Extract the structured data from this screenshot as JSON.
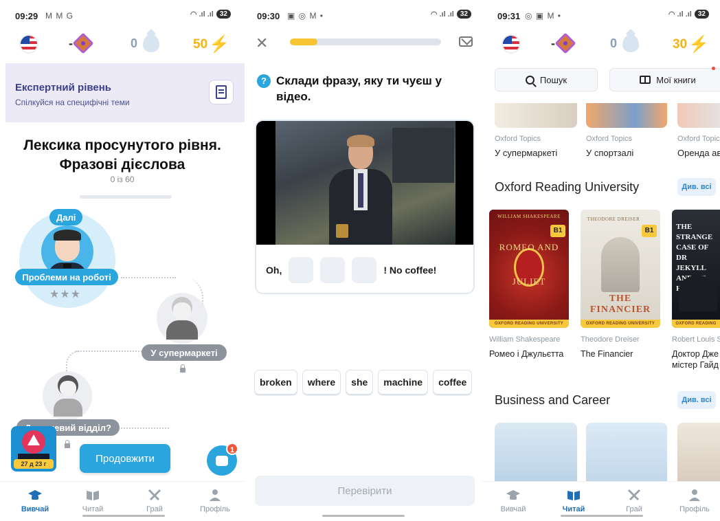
{
  "screen1": {
    "status": {
      "time": "09:29",
      "icons": "M M G",
      "battery": "32"
    },
    "top": {
      "gem_value": "-",
      "drops": "0",
      "energy": "50"
    },
    "expert": {
      "title": "Експертний рівень",
      "subtitle": "Спілкуйся на специфічні теми"
    },
    "lesson": {
      "title_line1": "Лексика просунутого рівня.",
      "title_line2": "Фразові дієслова",
      "progress": "0 із 60"
    },
    "path": {
      "next_label": "Далі",
      "nodes": [
        {
          "label": "Проблеми на роботі",
          "stars": "★★★"
        },
        {
          "label": "У супермаркеті"
        },
        {
          "label": "Д...овчевий відділ?"
        }
      ]
    },
    "promo_timer": "27 д 23 г",
    "continue_label": "Продовжити",
    "chat_badge": "1",
    "nav": [
      {
        "label": "Вивчай",
        "active": true
      },
      {
        "label": "Читай",
        "active": false
      },
      {
        "label": "Грай",
        "active": false
      },
      {
        "label": "Профіль",
        "active": false
      }
    ]
  },
  "screen2": {
    "status": {
      "time": "09:30",
      "icons": "▣ ◎ M •",
      "battery": "32"
    },
    "progress_fraction": 0.18,
    "question": "Склади фразу, яку ти чуєш у відео.",
    "answer": {
      "prefix": "Oh,",
      "suffix": "! No coffee!"
    },
    "words": [
      "broken",
      "where",
      "she",
      "machine",
      "coffee"
    ],
    "check_label": "Перевірити"
  },
  "screen3": {
    "status": {
      "time": "09:31",
      "icons": "◎ ▣ M •",
      "battery": "32"
    },
    "top": {
      "gem_value": "-",
      "drops": "0",
      "energy": "30"
    },
    "search_label": "Пошук",
    "my_books_label": "Мої книги",
    "topics": [
      {
        "source": "Oxford Topics",
        "name": "У супермаркеті"
      },
      {
        "source": "Oxford Topics",
        "name": "У спортзалі"
      },
      {
        "source": "Oxford Topic",
        "name": "Оренда ав"
      }
    ],
    "section1": {
      "title": "Oxford Reading University",
      "see_all": "Див. всі"
    },
    "books": [
      {
        "author": "William Shakespeare",
        "title": "Ромео і Джульєтта",
        "cover": "ROMEO AND JULIET",
        "cover_author": "WILLIAM SHAKESPEARE",
        "level": "B1",
        "series": "OXFORD READING UNIVERSITY"
      },
      {
        "author": "Theodore Dreiser",
        "title": "The Financier",
        "cover": "THE FINANCIER",
        "cover_author": "THEODORE DREISER",
        "level": "B1",
        "series": "OXFORD READING UNIVERSITY"
      },
      {
        "author": "Robert Louis S",
        "title_line1": "Доктор Дже",
        "title_line2": "містер Гайд",
        "cover": "THE STRANGE CASE OF DR JEKYLL AND MR HYDE",
        "series": "OXFORD READING"
      }
    ],
    "section2": {
      "title": "Business and Career",
      "see_all": "Див. всі"
    },
    "nav": [
      {
        "label": "Вивчай",
        "active": false
      },
      {
        "label": "Читай",
        "active": true
      },
      {
        "label": "Грай",
        "active": false
      },
      {
        "label": "Профіль",
        "active": false
      }
    ]
  }
}
